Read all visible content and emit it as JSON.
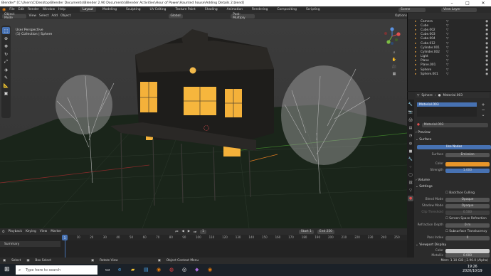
{
  "title": "Blender* [C:\\Users\\C\\Desktop\\Blender Documents\\Blender 2.90 Documents\\Blender Activities\\Hour of Power\\Haunted house\\Adding Details 2.blend]",
  "menu": [
    "File",
    "Edit",
    "Render",
    "Window",
    "Help"
  ],
  "workspaces": [
    "Layout",
    "Modeling",
    "Sculpting",
    "UV Editing",
    "Texture Paint",
    "Shading",
    "Animation",
    "Rendering",
    "Compositing",
    "Scripting"
  ],
  "scene": "Scene",
  "view_layer": "View Layer",
  "header": {
    "mode": "Object Mode",
    "items": [
      "View",
      "Select",
      "Add",
      "Object"
    ],
    "orientation": "Global",
    "snap": "Post-Multiply",
    "options": "Options"
  },
  "viewport_info": {
    "line1": "User Perspective",
    "line2": "(1) Collection | Sphere"
  },
  "outliner": [
    {
      "name": "Camera",
      "flt": "▽"
    },
    {
      "name": "Cube",
      "flt": "▽"
    },
    {
      "name": "Cube.002",
      "flt": "▽"
    },
    {
      "name": "Cube.003",
      "flt": "▽"
    },
    {
      "name": "Cube.004",
      "flt": "▽"
    },
    {
      "name": "Cube.012",
      "flt": "▽"
    },
    {
      "name": "Cylinder.001",
      "flt": "▽"
    },
    {
      "name": "Cylinder.002",
      "flt": "▽"
    },
    {
      "name": "Light",
      "flt": "▽"
    },
    {
      "name": "Plane",
      "flt": "▽"
    },
    {
      "name": "Plane.001",
      "flt": "▽"
    },
    {
      "name": "Sphere",
      "flt": "▽"
    },
    {
      "name": "Sphere.001",
      "flt": "▽"
    }
  ],
  "props": {
    "tab1": "Sphere",
    "tab2": "Material.003",
    "slot": "Material.003",
    "material": "Material.003",
    "preview": "Preview",
    "surface": "Surface",
    "use_nodes": "Use Nodes",
    "surface_lbl": "Surface",
    "surface_val": "Emission",
    "color_lbl": "Color",
    "strength_lbl": "Strength",
    "strength_val": "1.000",
    "volume": "Volume",
    "settings": "Settings",
    "backface": "Backface Culling",
    "blend_lbl": "Blend Mode",
    "blend_val": "Opaque",
    "shadow_lbl": "Shadow Mode",
    "shadow_val": "Opaque",
    "clip_lbl": "Clip Threshold",
    "clip_val": "0.500",
    "ssr": "Screen Space Refraction",
    "refr_lbl": "Refraction Depth",
    "refr_val": "0 m",
    "sss": "Subsurface Translucency",
    "pass_lbl": "Pass Index",
    "pass_val": "0",
    "viewport_display": "Viewport Display",
    "color2_lbl": "Color",
    "metallic_lbl": "Metallic",
    "metallic_val": "0.000",
    "accent": "#e8962a"
  },
  "timeline": {
    "items": [
      "Playback",
      "Keying",
      "View",
      "Marker"
    ],
    "frame": "1",
    "start_lbl": "Start",
    "start": "1",
    "end_lbl": "End",
    "end": "250",
    "ticks": [
      "0",
      "10",
      "20",
      "30",
      "40",
      "50",
      "60",
      "70",
      "80",
      "90",
      "100",
      "110",
      "120",
      "130",
      "140",
      "150",
      "160",
      "170",
      "180",
      "190",
      "200",
      "210",
      "220",
      "230",
      "240",
      "250"
    ],
    "summary": "Summary"
  },
  "status": {
    "select": "Select",
    "box": "Box Select",
    "rotate": "Rotate View",
    "context": "Object Context Menu",
    "stats": "Mem: 1.10 GiB | 2.90.0 (Alpha)"
  },
  "taskbar": {
    "search": "Type here to search",
    "time": "19:26",
    "date": "2020/10/19"
  }
}
